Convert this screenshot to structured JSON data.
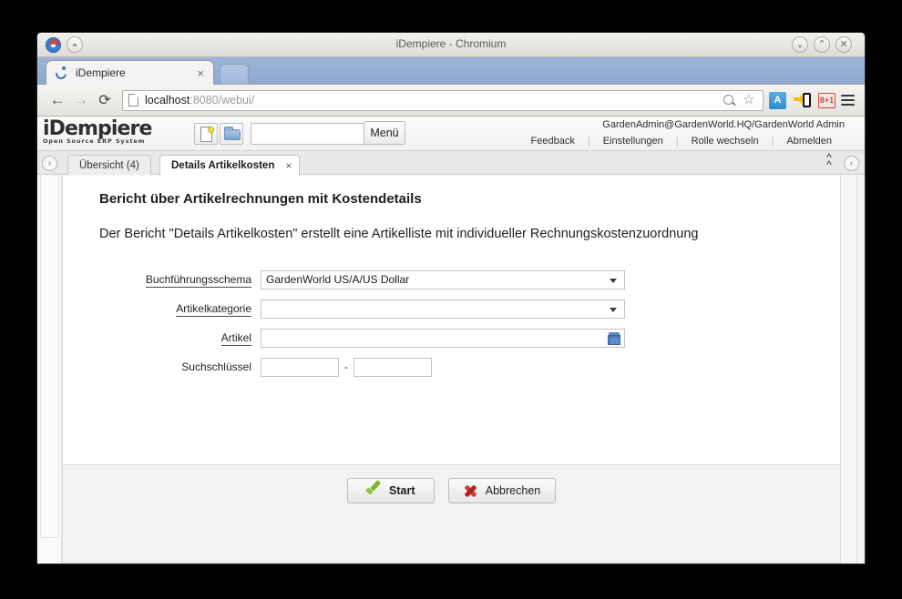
{
  "window": {
    "title": "iDempiere - Chromium",
    "minimize_label": "⌄",
    "maximize_label": "⌃",
    "close_label": "✕"
  },
  "browser": {
    "tab": {
      "title": "iDempiere",
      "close_label": "×",
      "favicon": "idempiere-favicon"
    },
    "new_tab_label": "",
    "back_label": "←",
    "forward_label": "→",
    "reload_label": "⟳",
    "url_host": "localhost",
    "url_rest": ":8080/webui/",
    "url_full": "localhost:8080/webui/",
    "star_label": "☆",
    "extensions": [
      {
        "name": "translate-extension",
        "label": "A"
      },
      {
        "name": "send-to-mobile-extension",
        "label": ""
      },
      {
        "name": "google-plus-one-extension",
        "label": "8+1"
      }
    ],
    "menu_label": "menu"
  },
  "app_header": {
    "brand_main": "iDempiere",
    "brand_sub": "Open Source  ERP System",
    "new_record_icon": "new-record-icon",
    "open_folder_icon": "open-folder-icon",
    "search_combo_value": "",
    "menu_button_label": "Menü",
    "user_info": "GardenAdmin@GardenWorld.HQ/GardenWorld Admin",
    "links": [
      {
        "label": "Feedback"
      },
      {
        "label": "Einstellungen"
      },
      {
        "label": "Rolle wechseln"
      },
      {
        "label": "Abmelden"
      }
    ]
  },
  "app_tabs": {
    "left_toggle_label": "›",
    "right_toggle_label": "‹",
    "collapse_label": "⌃",
    "items": [
      {
        "label": "Übersicht (4)",
        "active": false,
        "closable": false
      },
      {
        "label": "Details Artikelkosten",
        "active": true,
        "closable": true,
        "close_label": "×"
      }
    ]
  },
  "report": {
    "title": "Bericht über Artikelrechnungen mit Kostendetails",
    "description": "Der Bericht \"Details Artikelkosten\" erstellt eine Artikelliste mit individueller Rechnungskostenzuordnung",
    "fields": [
      {
        "name": "buchfuehrungsschema",
        "label": "Buchführungsschema",
        "underlined": true,
        "type": "select",
        "value": "GardenWorld US/A/US Dollar",
        "placeholder": ""
      },
      {
        "name": "artikelkategorie",
        "label": "Artikelkategorie",
        "underlined": true,
        "type": "select",
        "value": "",
        "placeholder": ""
      },
      {
        "name": "artikel",
        "label": "Artikel",
        "underlined": true,
        "type": "lookup",
        "value": "",
        "placeholder": "",
        "icon": "lookup-box-icon"
      },
      {
        "name": "suchschluessel",
        "label": "Suchschlüssel",
        "underlined": false,
        "type": "range",
        "value_from": "",
        "value_to": "",
        "separator": "-"
      }
    ]
  },
  "footer": {
    "start_label": "Start",
    "cancel_label": "Abbrechen",
    "start_icon": "green-check-icon",
    "cancel_icon": "red-x-icon"
  },
  "colors": {
    "accent_blue": "#4a78bd",
    "ok_green": "#8cc63f",
    "cancel_red": "#cc2b2b",
    "tabstrip_blue": "#8ea9d0"
  }
}
